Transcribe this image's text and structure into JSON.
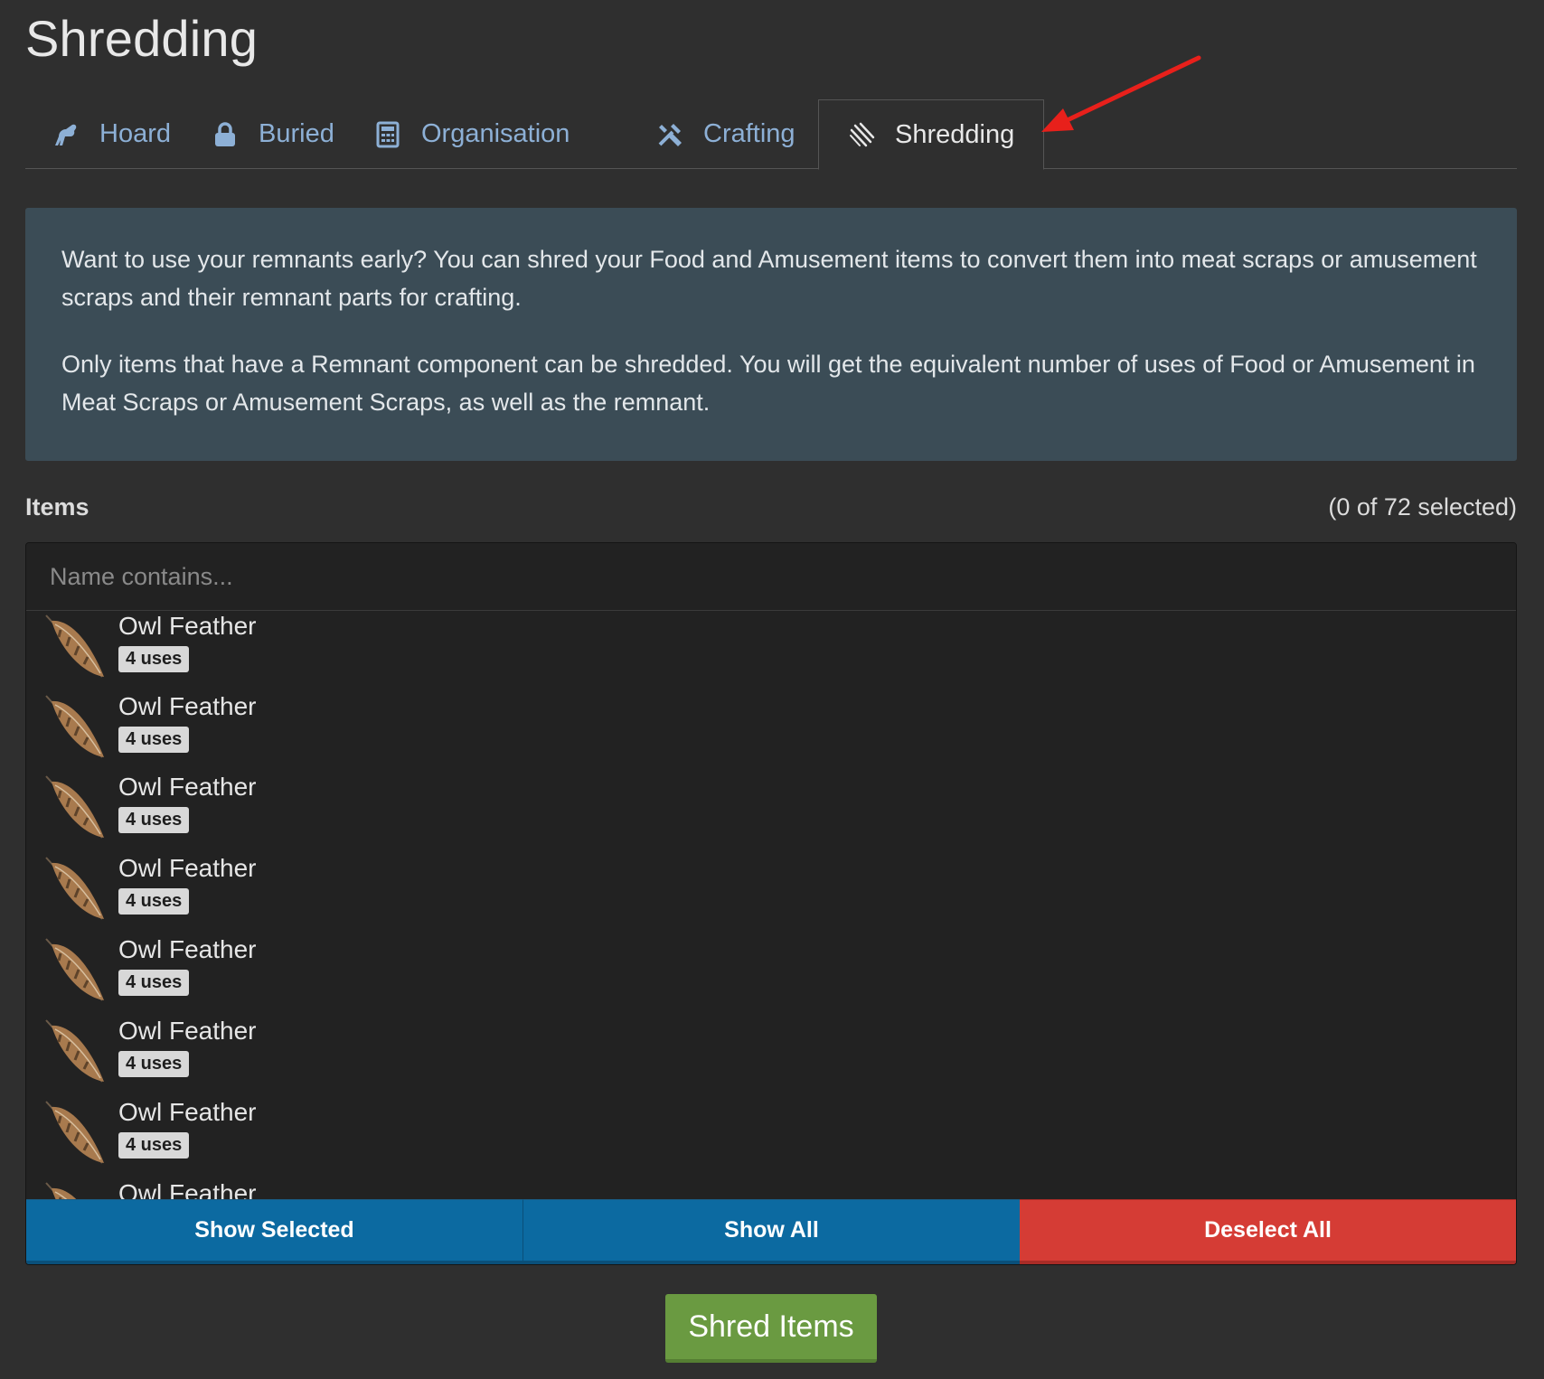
{
  "page": {
    "title": "Shredding"
  },
  "tabs": [
    {
      "label": "Hoard",
      "icon": "dinosaur-icon",
      "active": false
    },
    {
      "label": "Buried",
      "icon": "lock-icon",
      "active": false
    },
    {
      "label": "Organisation",
      "icon": "calculator-icon",
      "active": false
    },
    {
      "label": "Crafting",
      "icon": "tools-icon",
      "active": false
    },
    {
      "label": "Shredding",
      "icon": "claw-marks-icon",
      "active": true
    }
  ],
  "info": {
    "paragraph1": "Want to use your remnants early? You can shred your Food and Amusement items to convert them into meat scraps or amusement scraps and their remnant parts for crafting.",
    "paragraph2": "Only items that have a Remnant component can be shredded. You will get the equivalent number of uses of Food or Amusement in Meat Scraps or Amusement Scraps, as well as the remnant."
  },
  "items": {
    "label": "Items",
    "count_text": "(0 of 72 selected)",
    "search_placeholder": "Name contains...",
    "list": [
      {
        "name": "Owl Feather",
        "badge": "4 uses"
      },
      {
        "name": "Owl Feather",
        "badge": "4 uses"
      },
      {
        "name": "Owl Feather",
        "badge": "4 uses"
      },
      {
        "name": "Owl Feather",
        "badge": "4 uses"
      },
      {
        "name": "Owl Feather",
        "badge": "4 uses"
      },
      {
        "name": "Owl Feather",
        "badge": "4 uses"
      },
      {
        "name": "Owl Feather",
        "badge": "4 uses"
      },
      {
        "name": "Owl Feather",
        "badge": ""
      }
    ]
  },
  "buttons": {
    "show_selected": "Show Selected",
    "show_all": "Show All",
    "deselect_all": "Deselect All",
    "shred": "Shred Items"
  },
  "colors": {
    "background": "#2f2f2f",
    "tab_link": "#8db0d6",
    "info_panel": "#3b4c56",
    "button_blue": "#0c6aa1",
    "button_red": "#d53c35",
    "button_green": "#6a9a41",
    "annotation_arrow": "#e8201b"
  }
}
